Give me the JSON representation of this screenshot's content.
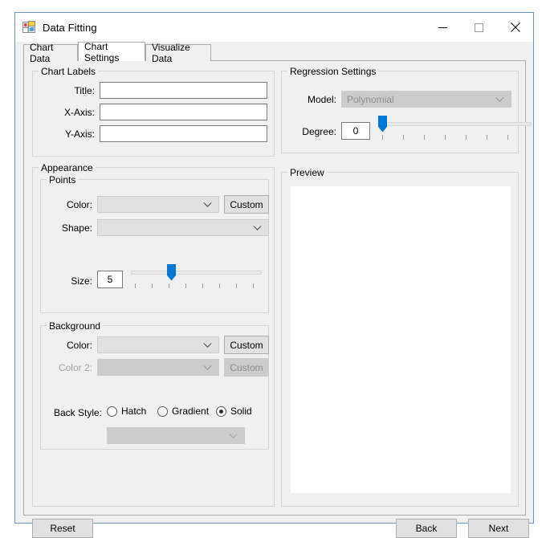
{
  "window": {
    "title": "Data Fitting",
    "icon": "winforms-app-icon",
    "controls": {
      "minimize": "minimize-icon",
      "maximize": "maximize-icon",
      "close": "close-icon"
    }
  },
  "tabs": [
    {
      "label": "Chart Data",
      "selected": false
    },
    {
      "label": "Chart Settings",
      "selected": true
    },
    {
      "label": "Visualize Data",
      "selected": false
    }
  ],
  "chart_labels": {
    "group_title": "Chart Labels",
    "fields": [
      {
        "label": "Title:",
        "value": "",
        "placeholder": ""
      },
      {
        "label": "X-Axis:",
        "value": "",
        "placeholder": ""
      },
      {
        "label": "Y-Axis:",
        "value": "",
        "placeholder": ""
      }
    ]
  },
  "regression": {
    "group_title": "Regression Settings",
    "model_label": "Model:",
    "model_value": "Polynomial",
    "model_enabled": false,
    "degree_label": "Degree:",
    "degree_value": "0",
    "degree_slider": {
      "value": 0,
      "min": 0,
      "max": 7,
      "ticks": 7
    }
  },
  "appearance": {
    "group_title": "Appearance",
    "points": {
      "group_title": "Points",
      "color_label": "Color:",
      "color_value": "",
      "color_custom_label": "Custom",
      "shape_label": "Shape:",
      "shape_value": "",
      "size_label": "Size:",
      "size_value": "5",
      "size_slider": {
        "value": 2,
        "min": 0,
        "max": 7,
        "ticks": 8
      }
    },
    "background": {
      "group_title": "Background",
      "color_label": "Color:",
      "color_value": "",
      "color_custom_label": "Custom",
      "color2_label": "Color 2:",
      "color2_value": "",
      "color2_custom_label": "Custom",
      "color2_enabled": false,
      "back_style_label": "Back Style:",
      "options": [
        {
          "label": "Hatch",
          "selected": false
        },
        {
          "label": "Gradient",
          "selected": false
        },
        {
          "label": "Solid",
          "selected": true
        }
      ],
      "style_combo_value": "",
      "style_combo_enabled": false
    }
  },
  "preview": {
    "group_title": "Preview",
    "surface_color": "#ffffff"
  },
  "footer": {
    "reset_label": "Reset",
    "back_label": "Back",
    "next_label": "Next"
  },
  "colors": {
    "accent": "#0078d7",
    "window_border": "#6f94bc",
    "face": "#f0f0f0",
    "control": "#e1e1e1",
    "disabled": "#cccccc"
  }
}
